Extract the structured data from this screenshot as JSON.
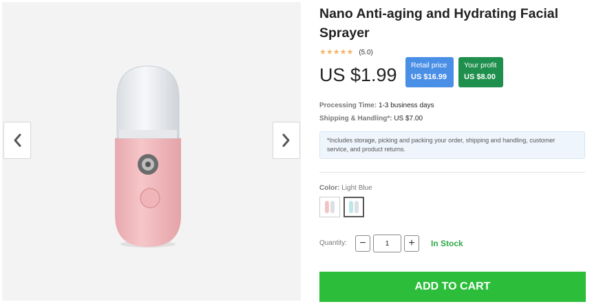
{
  "product": {
    "title": "Nano Anti-aging and Hydrating Facial Sprayer",
    "rating_stars": "★★★★★",
    "rating_score": "(5.0)",
    "rating_value": 5.0,
    "price": "US $1.99",
    "retail_label": "Retail price",
    "retail_value": "US $16.99",
    "profit_label": "Your profit",
    "profit_value": "US $8.00"
  },
  "shipping": {
    "processing_label": "Processing Time:",
    "processing_value": "1-3 business days",
    "handling_label": "Shipping & Handling*:",
    "handling_value": "US $7.00",
    "notice": "*Includes storage, picking and packing your order, shipping and handling, customer service, and product returns."
  },
  "variant": {
    "color_label": "Color:",
    "color_value": "Light Blue"
  },
  "quantity": {
    "label": "Quantity:",
    "minus": "−",
    "plus": "+",
    "value": "1"
  },
  "stock_status": "In Stock",
  "cart_button": "ADD TO CART",
  "colors": {
    "accent_green": "#2cbe3a",
    "retail_blue": "#4a8fe6",
    "profit_green": "#1e8f4c",
    "stock_green": "#2fa84a",
    "star": "#f1b56b"
  }
}
